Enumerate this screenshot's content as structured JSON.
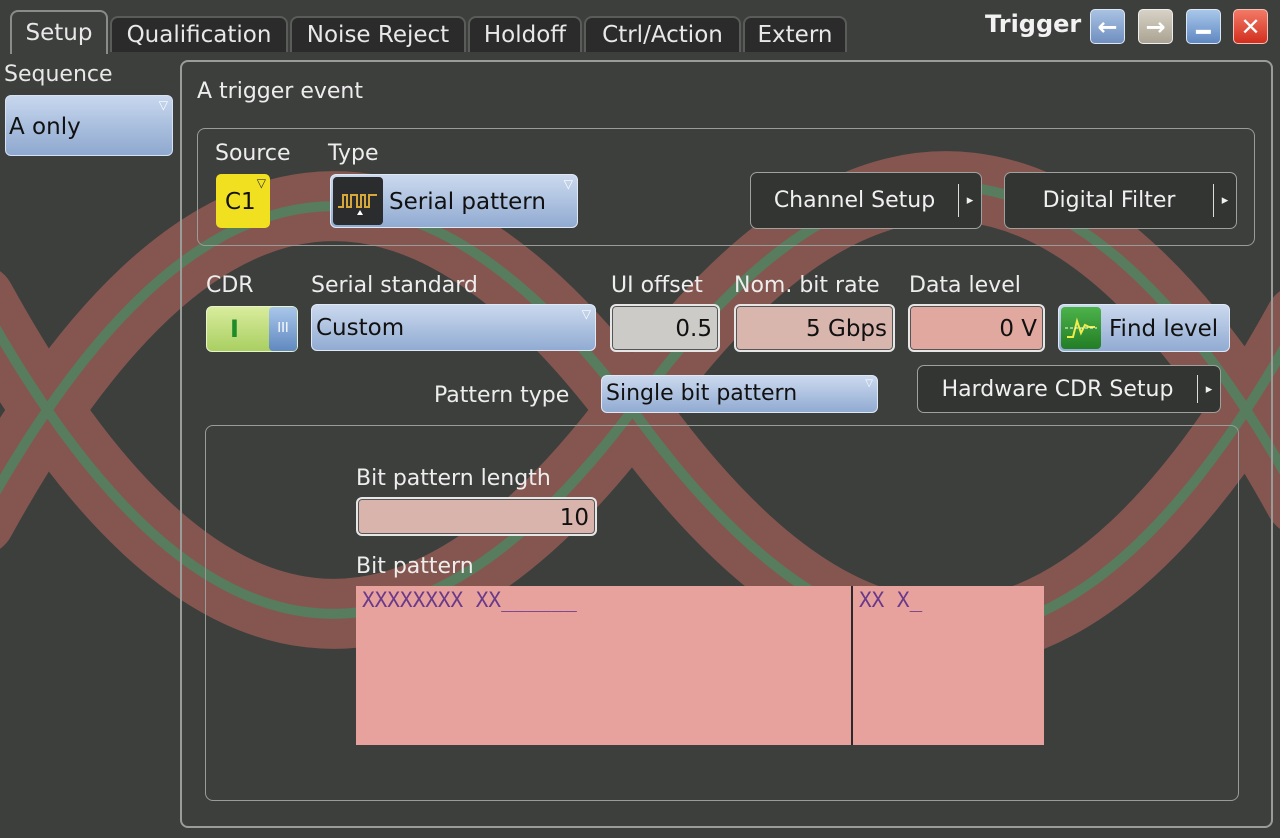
{
  "window": {
    "title": "Trigger"
  },
  "tabs": [
    "Setup",
    "Qualification",
    "Noise Reject",
    "Holdoff",
    "Ctrl/Action",
    "Extern"
  ],
  "sequence": {
    "label": "Sequence",
    "value": "A only"
  },
  "event": {
    "title": "A trigger event"
  },
  "source": {
    "label": "Source",
    "value": "C1"
  },
  "type": {
    "label": "Type",
    "value": "Serial pattern"
  },
  "buttons": {
    "channel_setup": "Channel Setup",
    "digital_filter": "Digital Filter",
    "hardware_cdr": "Hardware CDR Setup",
    "find_level": "Find level"
  },
  "cdr": {
    "label": "CDR",
    "on_glyph": "I",
    "off_glyph": "III"
  },
  "serial_standard": {
    "label": "Serial standard",
    "value": "Custom"
  },
  "ui_offset": {
    "label": "UI offset",
    "value": "0.5"
  },
  "nom_bit_rate": {
    "label": "Nom. bit rate",
    "value": "5 Gbps"
  },
  "data_level": {
    "label": "Data level",
    "value": "0 V"
  },
  "pattern_type": {
    "label": "Pattern type",
    "value": "Single bit pattern"
  },
  "bit_pattern_length": {
    "label": "Bit pattern length",
    "value": "10"
  },
  "bit_pattern": {
    "label": "Bit pattern",
    "left": "XXXXXXXX XX______",
    "right": "XX X_"
  },
  "colors": {
    "accent_blue": "#91abd2",
    "source_yellow": "#f0e020",
    "field_pink": "#e8a29e",
    "close_red": "#e03a2a"
  }
}
